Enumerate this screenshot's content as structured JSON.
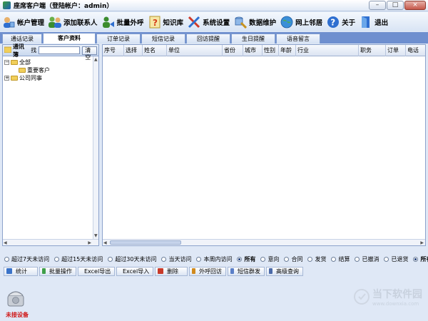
{
  "window": {
    "title": "座席客户端（登陆帐户：admin）",
    "controls": [
      "–",
      "□",
      "×"
    ]
  },
  "toolbar": {
    "items": [
      {
        "label": "帐户管理",
        "icon": "user-account-icon"
      },
      {
        "label": "添加联系人",
        "icon": "add-contact-icon"
      },
      {
        "label": "批量外呼",
        "icon": "batch-call-icon"
      },
      {
        "label": "知识库",
        "icon": "knowledge-base-icon"
      },
      {
        "label": "系统设置",
        "icon": "tools-icon"
      },
      {
        "label": "数据维护",
        "icon": "data-maintenance-icon"
      },
      {
        "label": "网上邻居",
        "icon": "globe-icon"
      },
      {
        "label": "关于",
        "icon": "help-icon"
      },
      {
        "label": "退出",
        "icon": "exit-icon"
      }
    ]
  },
  "tabs": [
    {
      "label": "通话记录",
      "active": false
    },
    {
      "label": "客户资料",
      "active": true
    },
    {
      "label": "订单记录",
      "active": false
    },
    {
      "label": "短信记录",
      "active": false
    },
    {
      "label": "回访提醒",
      "active": false
    },
    {
      "label": "生日提醒",
      "active": false
    },
    {
      "label": "语音留言",
      "active": false
    }
  ],
  "left_panel": {
    "title": "通讯簿",
    "find_label": "找",
    "search_value": "",
    "clear_label": "清空",
    "tree": [
      {
        "label": "全部",
        "expander": "−",
        "level": 0
      },
      {
        "label": "重要客户",
        "expander": "",
        "level": 1
      },
      {
        "label": "公司同事",
        "expander": "+",
        "level": 0
      }
    ]
  },
  "grid": {
    "columns": [
      "序号",
      "选择",
      "姓名",
      "单位",
      "省份",
      "城市",
      "性别",
      "年龄",
      "行业",
      "职务",
      "订单",
      "电话"
    ]
  },
  "filters": [
    {
      "label": "超过7天未访问",
      "checked": false
    },
    {
      "label": "超过15天未访问",
      "checked": false
    },
    {
      "label": "超过30天未访问",
      "checked": false
    },
    {
      "label": "当天访问",
      "checked": false
    },
    {
      "label": "本周内访问",
      "checked": false
    },
    {
      "label": "所有",
      "checked": true
    },
    {
      "label": "意向",
      "checked": false
    },
    {
      "label": "合同",
      "checked": false
    },
    {
      "label": "发货",
      "checked": false
    },
    {
      "label": "结算",
      "checked": false
    },
    {
      "label": "已撤消",
      "checked": false
    },
    {
      "label": "已退货",
      "checked": false
    },
    {
      "label": "所有",
      "checked": true
    }
  ],
  "actions": [
    {
      "label": "统计",
      "color": "#3a73c9"
    },
    {
      "label": "批量操作",
      "color": "#3f9f4a"
    },
    {
      "label": "Excel导出",
      "color": "#2f8a3c"
    },
    {
      "label": "Excel导入",
      "color": "#2f8a3c"
    },
    {
      "label": "删除",
      "color": "#c83a2a"
    },
    {
      "label": "外呼回访",
      "color": "#d08a1e"
    },
    {
      "label": "短信群发",
      "color": "#5a7fc8"
    },
    {
      "label": "高级查询",
      "color": "#4b6aa8"
    }
  ],
  "status": {
    "device_label": "未接设备"
  },
  "watermark": {
    "text": "当下软件园",
    "url": "www.downxia.com"
  }
}
